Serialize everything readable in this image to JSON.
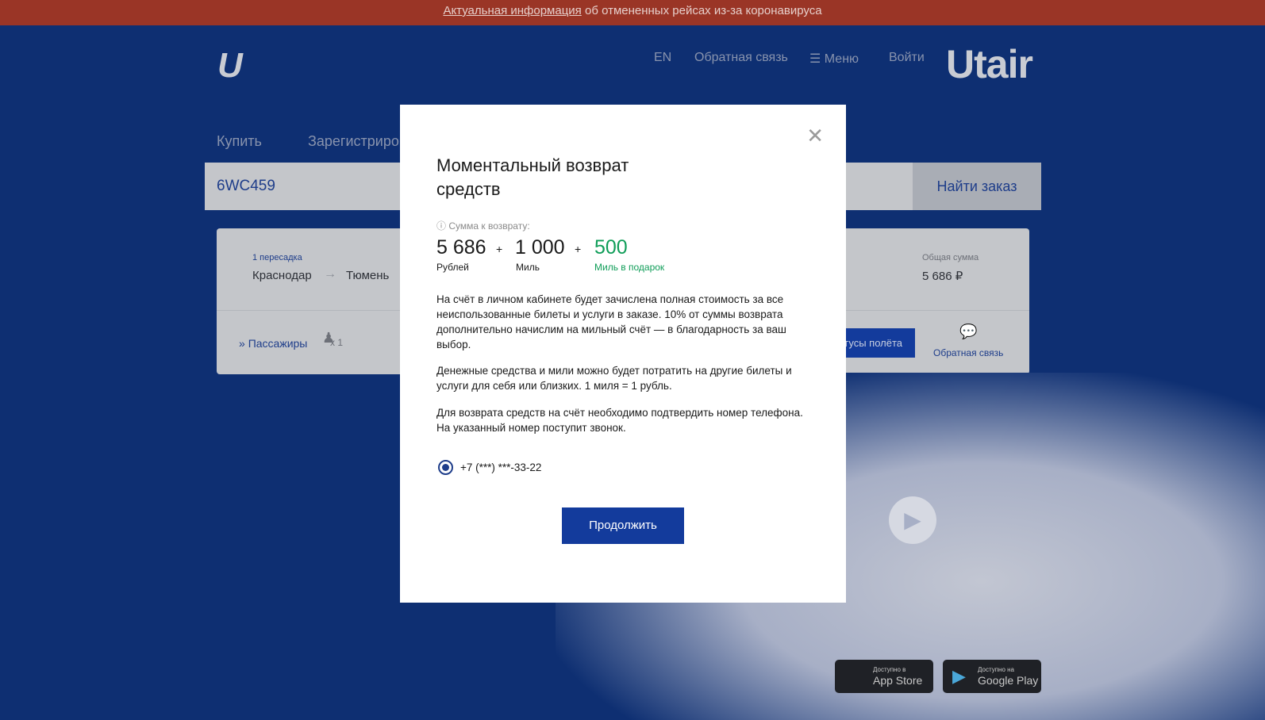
{
  "banner": {
    "link": "Актуальная информация",
    "text": " об отмененных рейсах из-за коронавируса"
  },
  "header": {
    "lang": "EN",
    "feedback": "Обратная связь",
    "menu": "Меню",
    "login": "Войти",
    "brand": "Utair",
    "logo": "U"
  },
  "tabs": [
    "Купить",
    "Зарегистрироваться"
  ],
  "search": {
    "value": "6WC459",
    "button": "Найти заказ"
  },
  "order": {
    "transfers": "1 пересадка",
    "from": "Краснодар",
    "to": "Тюмень",
    "total_label": "Общая сумма",
    "total": "5 686 ₽",
    "passengers": "Пассажиры",
    "pax_count": "x 1",
    "status_button": "Статусы полёта",
    "feedback": "Обратная связь"
  },
  "stores": [
    {
      "small": "Доступно в",
      "name": "App Store"
    },
    {
      "small": "Доступно на",
      "name": "Google Play"
    }
  ],
  "modal": {
    "title": "Моментальный возврат средств",
    "amount_label": "Сумма к возврату:",
    "rub": "5 686",
    "rub_label": "Рублей",
    "miles": "1 000",
    "miles_label": "Миль",
    "gift": "500",
    "gift_label": "Миль в подарок",
    "p1": "На счёт в личном кабинете будет зачислена полная стоимость за все неиспользованные билеты и услуги в заказе. 10% от суммы возврата дополнительно начислим на мильный счёт — в благодарность за ваш выбор.",
    "p2": "Денежные средства и мили можно будет потратить на другие билеты и услуги для себя или близких. 1 миля = 1 рубль.",
    "p3": "Для возврата средств на счёт необходимо подтвердить номер телефона. На указанный номер поступит звонок.",
    "phone": "+7 (***) ***-33-22",
    "continue": "Продолжить",
    "plus": "+"
  },
  "colors": {
    "brand_blue": "#0e2f72",
    "accent": "#133b9c",
    "gift_green": "#0f9d58",
    "banner": "#9a3526"
  }
}
